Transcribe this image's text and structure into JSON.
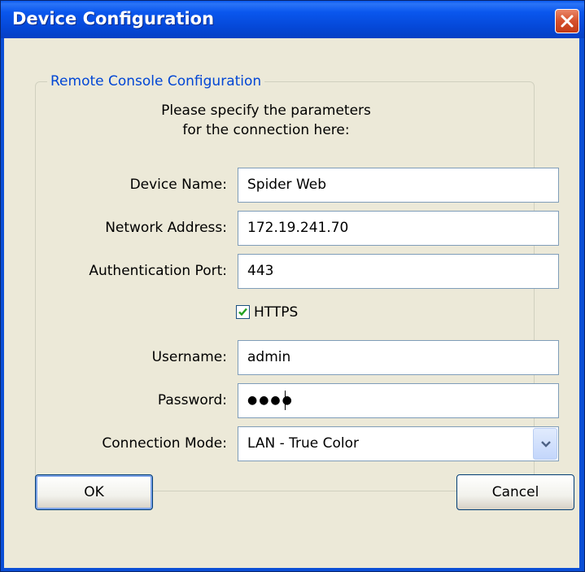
{
  "window": {
    "title": "Device Configuration"
  },
  "group": {
    "legend": "Remote Console Configuration",
    "instructions_line1": "Please specify the parameters",
    "instructions_line2": "for the connection here:"
  },
  "form": {
    "device_name": {
      "label": "Device Name:",
      "value": "Spider Web"
    },
    "network_address": {
      "label": "Network Address:",
      "value": "172.19.241.70"
    },
    "auth_port": {
      "label": "Authentication Port:",
      "value": "443"
    },
    "https": {
      "label": "HTTPS",
      "checked": true
    },
    "username": {
      "label": "Username:",
      "value": "admin"
    },
    "password": {
      "label": "Password:",
      "value": "●●●●"
    },
    "connection_mode": {
      "label": "Connection Mode:",
      "value": "LAN - True Color"
    }
  },
  "buttons": {
    "ok": "OK",
    "cancel": "Cancel"
  },
  "icons": {
    "close": "close-icon",
    "checkmark": "checkmark-icon",
    "dropdown": "chevron-down-icon"
  },
  "colors": {
    "titlebar": "#0548d8",
    "close_button": "#d6502c",
    "dialog_background": "#ece9d8",
    "legend_text": "#0046d5",
    "checkmark": "#21a121"
  }
}
